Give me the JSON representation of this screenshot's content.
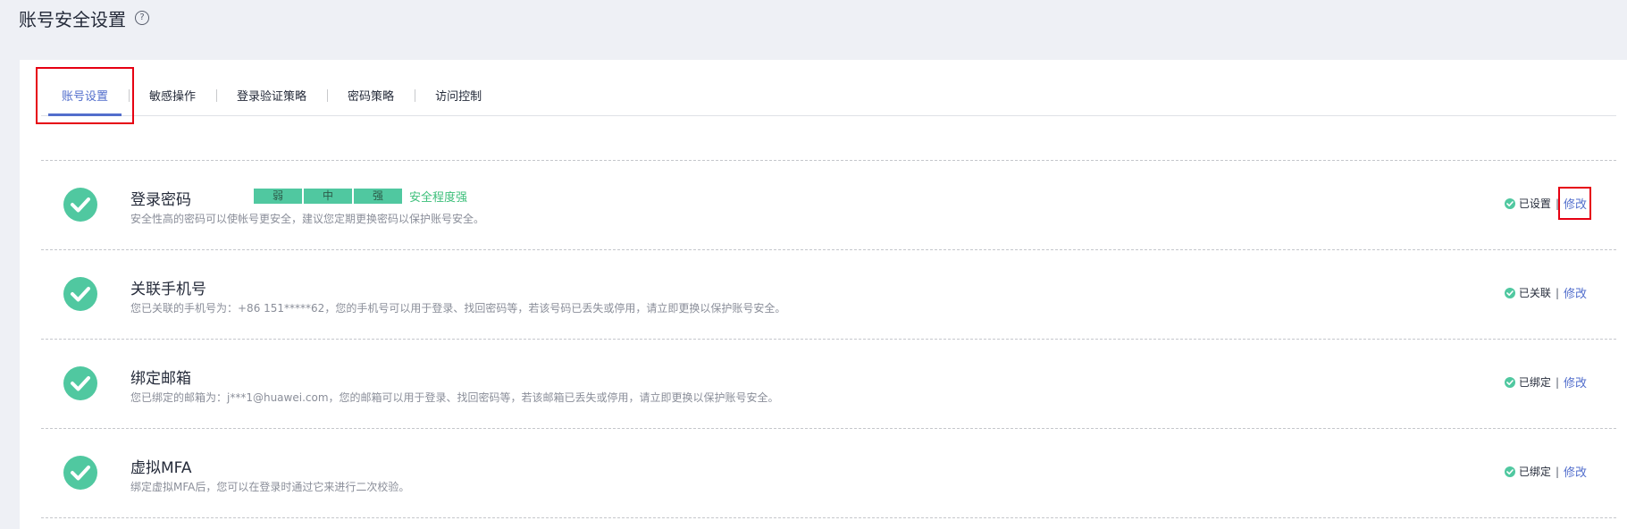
{
  "page": {
    "title": "账号安全设置",
    "help_icon": "question-circle-icon"
  },
  "tabs": [
    {
      "label": "账号设置",
      "active": true
    },
    {
      "label": "敏感操作",
      "active": false
    },
    {
      "label": "登录验证策略",
      "active": false
    },
    {
      "label": "密码策略",
      "active": false
    },
    {
      "label": "访问控制",
      "active": false
    }
  ],
  "rows": [
    {
      "title": "登录密码",
      "description": "安全性高的密码可以使帐号更安全，建议您定期更换密码以保护账号安全。",
      "strength": {
        "levels": [
          "弱",
          "中",
          "强"
        ],
        "label": "安全程度强"
      },
      "status": "已设置",
      "action": "修改"
    },
    {
      "title": "关联手机号",
      "description": "您已关联的手机号为：+86 151*****62，您的手机号可以用于登录、找回密码等，若该号码已丢失或停用，请立即更换以保护账号安全。",
      "status": "已关联",
      "action": "修改"
    },
    {
      "title": "绑定邮箱",
      "description": "您已绑定的邮箱为：j***1@huawei.com，您的邮箱可以用于登录、找回密码等，若该邮箱已丢失或停用，请立即更换以保护账号安全。",
      "status": "已绑定",
      "action": "修改"
    },
    {
      "title": "虚拟MFA",
      "description": "绑定虚拟MFA后，您可以在登录时通过它来进行二次校验。",
      "status": "已绑定",
      "action": "修改"
    }
  ],
  "colors": {
    "accent": "#526ecc",
    "success": "#50c8a0",
    "highlight_box": "#e60012"
  }
}
